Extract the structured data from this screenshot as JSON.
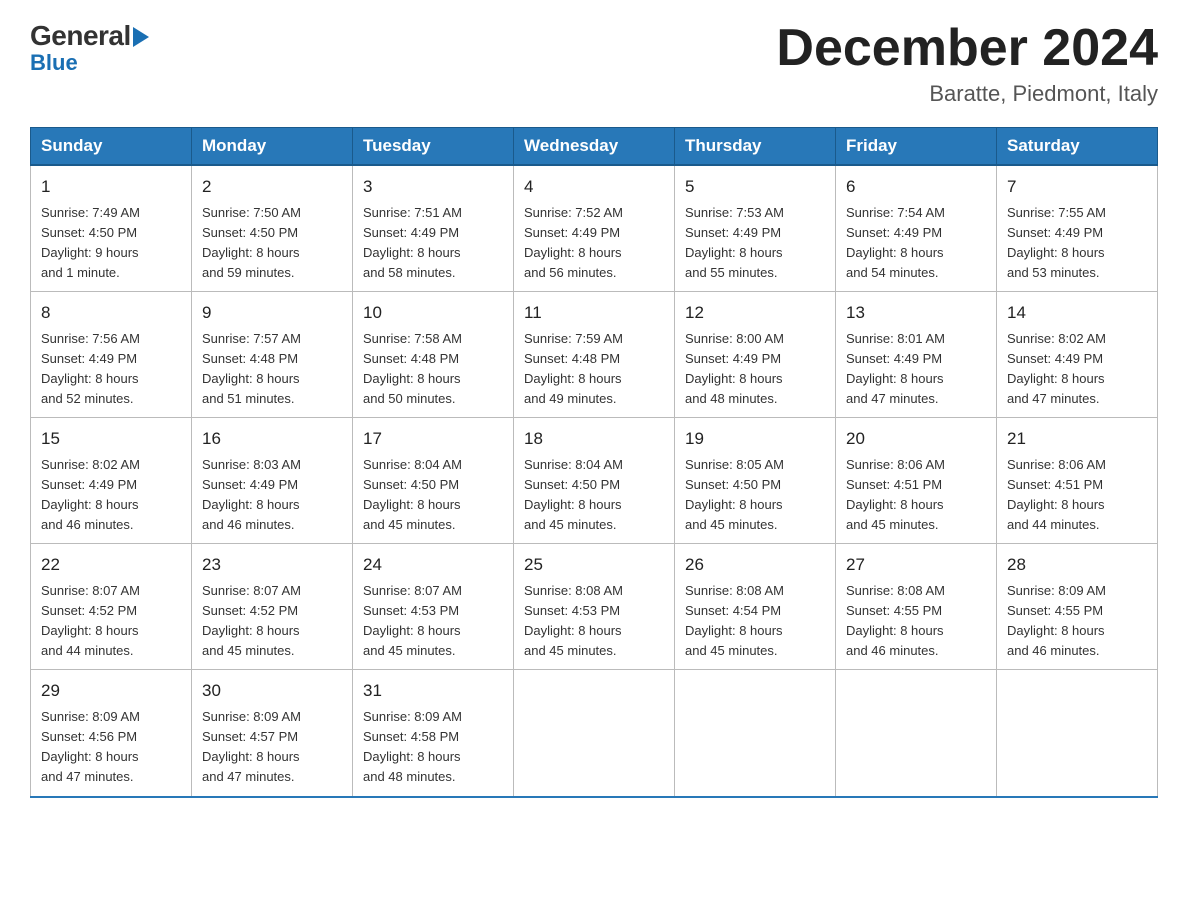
{
  "logo": {
    "general": "General",
    "blue": "Blue",
    "arrow": "▶"
  },
  "title": "December 2024",
  "location": "Baratte, Piedmont, Italy",
  "days_of_week": [
    "Sunday",
    "Monday",
    "Tuesday",
    "Wednesday",
    "Thursday",
    "Friday",
    "Saturday"
  ],
  "weeks": [
    [
      {
        "day": "1",
        "sunrise": "7:49 AM",
        "sunset": "4:50 PM",
        "daylight": "9 hours and 1 minute."
      },
      {
        "day": "2",
        "sunrise": "7:50 AM",
        "sunset": "4:50 PM",
        "daylight": "8 hours and 59 minutes."
      },
      {
        "day": "3",
        "sunrise": "7:51 AM",
        "sunset": "4:49 PM",
        "daylight": "8 hours and 58 minutes."
      },
      {
        "day": "4",
        "sunrise": "7:52 AM",
        "sunset": "4:49 PM",
        "daylight": "8 hours and 56 minutes."
      },
      {
        "day": "5",
        "sunrise": "7:53 AM",
        "sunset": "4:49 PM",
        "daylight": "8 hours and 55 minutes."
      },
      {
        "day": "6",
        "sunrise": "7:54 AM",
        "sunset": "4:49 PM",
        "daylight": "8 hours and 54 minutes."
      },
      {
        "day": "7",
        "sunrise": "7:55 AM",
        "sunset": "4:49 PM",
        "daylight": "8 hours and 53 minutes."
      }
    ],
    [
      {
        "day": "8",
        "sunrise": "7:56 AM",
        "sunset": "4:49 PM",
        "daylight": "8 hours and 52 minutes."
      },
      {
        "day": "9",
        "sunrise": "7:57 AM",
        "sunset": "4:48 PM",
        "daylight": "8 hours and 51 minutes."
      },
      {
        "day": "10",
        "sunrise": "7:58 AM",
        "sunset": "4:48 PM",
        "daylight": "8 hours and 50 minutes."
      },
      {
        "day": "11",
        "sunrise": "7:59 AM",
        "sunset": "4:48 PM",
        "daylight": "8 hours and 49 minutes."
      },
      {
        "day": "12",
        "sunrise": "8:00 AM",
        "sunset": "4:49 PM",
        "daylight": "8 hours and 48 minutes."
      },
      {
        "day": "13",
        "sunrise": "8:01 AM",
        "sunset": "4:49 PM",
        "daylight": "8 hours and 47 minutes."
      },
      {
        "day": "14",
        "sunrise": "8:02 AM",
        "sunset": "4:49 PM",
        "daylight": "8 hours and 47 minutes."
      }
    ],
    [
      {
        "day": "15",
        "sunrise": "8:02 AM",
        "sunset": "4:49 PM",
        "daylight": "8 hours and 46 minutes."
      },
      {
        "day": "16",
        "sunrise": "8:03 AM",
        "sunset": "4:49 PM",
        "daylight": "8 hours and 46 minutes."
      },
      {
        "day": "17",
        "sunrise": "8:04 AM",
        "sunset": "4:50 PM",
        "daylight": "8 hours and 45 minutes."
      },
      {
        "day": "18",
        "sunrise": "8:04 AM",
        "sunset": "4:50 PM",
        "daylight": "8 hours and 45 minutes."
      },
      {
        "day": "19",
        "sunrise": "8:05 AM",
        "sunset": "4:50 PM",
        "daylight": "8 hours and 45 minutes."
      },
      {
        "day": "20",
        "sunrise": "8:06 AM",
        "sunset": "4:51 PM",
        "daylight": "8 hours and 45 minutes."
      },
      {
        "day": "21",
        "sunrise": "8:06 AM",
        "sunset": "4:51 PM",
        "daylight": "8 hours and 44 minutes."
      }
    ],
    [
      {
        "day": "22",
        "sunrise": "8:07 AM",
        "sunset": "4:52 PM",
        "daylight": "8 hours and 44 minutes."
      },
      {
        "day": "23",
        "sunrise": "8:07 AM",
        "sunset": "4:52 PM",
        "daylight": "8 hours and 45 minutes."
      },
      {
        "day": "24",
        "sunrise": "8:07 AM",
        "sunset": "4:53 PM",
        "daylight": "8 hours and 45 minutes."
      },
      {
        "day": "25",
        "sunrise": "8:08 AM",
        "sunset": "4:53 PM",
        "daylight": "8 hours and 45 minutes."
      },
      {
        "day": "26",
        "sunrise": "8:08 AM",
        "sunset": "4:54 PM",
        "daylight": "8 hours and 45 minutes."
      },
      {
        "day": "27",
        "sunrise": "8:08 AM",
        "sunset": "4:55 PM",
        "daylight": "8 hours and 46 minutes."
      },
      {
        "day": "28",
        "sunrise": "8:09 AM",
        "sunset": "4:55 PM",
        "daylight": "8 hours and 46 minutes."
      }
    ],
    [
      {
        "day": "29",
        "sunrise": "8:09 AM",
        "sunset": "4:56 PM",
        "daylight": "8 hours and 47 minutes."
      },
      {
        "day": "30",
        "sunrise": "8:09 AM",
        "sunset": "4:57 PM",
        "daylight": "8 hours and 47 minutes."
      },
      {
        "day": "31",
        "sunrise": "8:09 AM",
        "sunset": "4:58 PM",
        "daylight": "8 hours and 48 minutes."
      },
      null,
      null,
      null,
      null
    ]
  ],
  "labels": {
    "sunrise": "Sunrise:",
    "sunset": "Sunset:",
    "daylight": "Daylight:"
  }
}
